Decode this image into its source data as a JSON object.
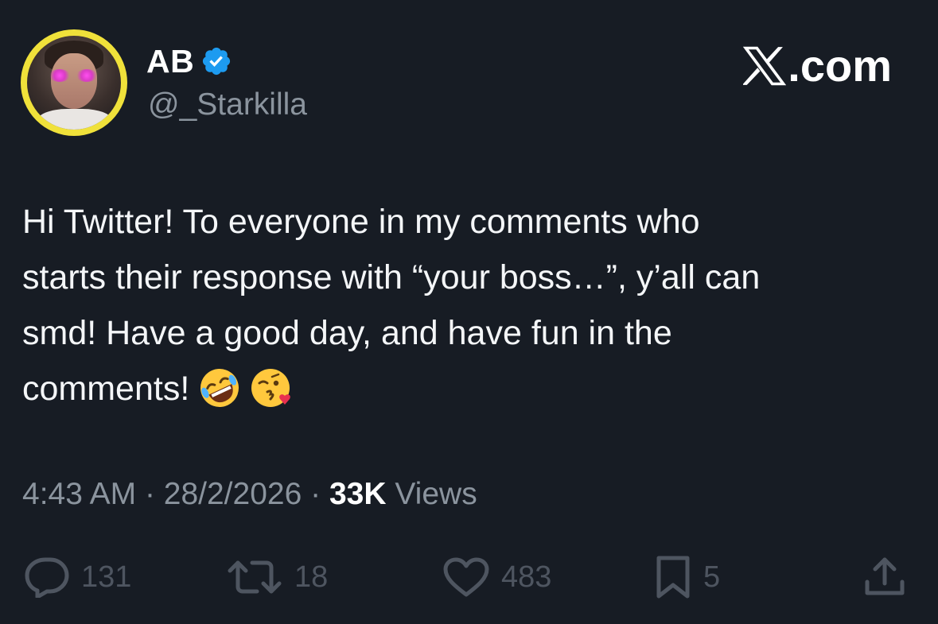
{
  "brand": {
    "label": ".com"
  },
  "author": {
    "display_name": "AB",
    "handle": "@_Starkilla",
    "verified": true
  },
  "tweet": {
    "lines": [
      "Hi Twitter! To everyone in my comments who",
      "starts their response with “your boss…”, y’all can",
      "smd! Have a good day, and have fun in the",
      "comments!"
    ],
    "emojis": [
      "rolling-on-floor-laughing-emoji",
      "face-blowing-kiss-emoji"
    ]
  },
  "meta": {
    "time": "4:43 AM",
    "separator": "·",
    "date": "28/2/2026",
    "views_count": "33K",
    "views_label": "Views"
  },
  "actions": {
    "replies": "131",
    "reposts": "18",
    "likes": "483",
    "bookmarks": "5"
  },
  "colors": {
    "background": "#171c24",
    "avatar_ring": "#f0e13a",
    "verified": "#1d9bf0",
    "muted_text": "#8b949e",
    "action_icons": "#4e5560"
  }
}
